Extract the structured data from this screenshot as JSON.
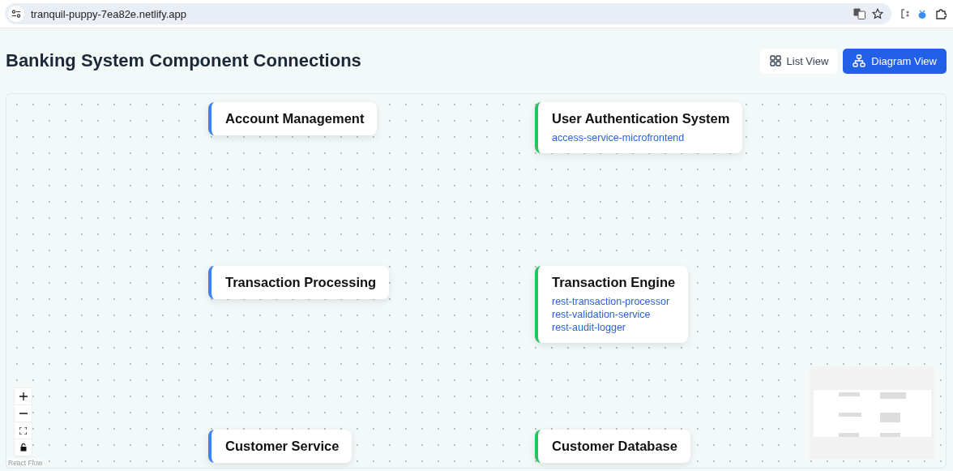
{
  "browser": {
    "url": "tranquil-puppy-7ea82e.netlify.app"
  },
  "page": {
    "title": "Banking System Component Connections"
  },
  "view_toggle": [
    {
      "label": "List View",
      "kind": "list",
      "selected": false
    },
    {
      "label": "Diagram View",
      "kind": "diagram",
      "selected": true
    }
  ],
  "nodes": [
    {
      "title": "Account Management",
      "kind": "source"
    },
    {
      "title": "User Authentication System",
      "kind": "target",
      "services": [
        "access-service-microfrontend"
      ]
    },
    {
      "title": "Transaction Processing",
      "kind": "source"
    },
    {
      "title": "Transaction Engine",
      "kind": "target",
      "services": [
        "rest-transaction-processor",
        "rest-validation-service",
        "rest-audit-logger"
      ]
    },
    {
      "title": "Customer Service",
      "kind": "source"
    },
    {
      "title": "Customer Database",
      "kind": "target"
    }
  ],
  "attribution": "React Flow"
}
